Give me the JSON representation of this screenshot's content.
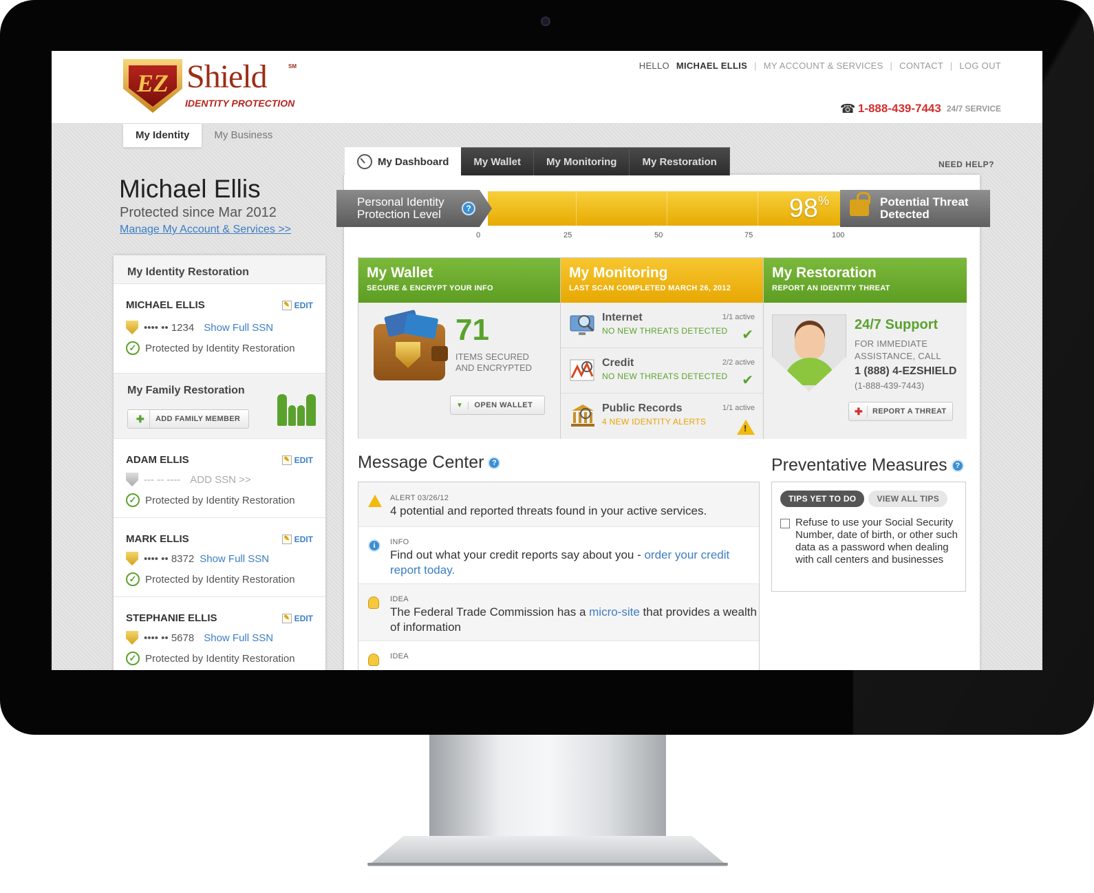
{
  "header": {
    "brand": {
      "word": "Shield",
      "badge": "EZ",
      "sub": "IDENTITY PROTECTION",
      "mark": "SM"
    },
    "links": {
      "hello": "HELLO",
      "user": "MICHAEL ELLIS",
      "sep": "|",
      "account": "MY ACCOUNT & SERVICES",
      "contact": "CONTACT",
      "logout": "LOG OUT"
    },
    "phone": {
      "number": "1-888-439-7443",
      "service": "24/7 SERVICE"
    }
  },
  "identity_tabs": [
    {
      "label": "My Identity",
      "active": true
    },
    {
      "label": "My Business",
      "active": false
    }
  ],
  "profile": {
    "name": "Michael Ellis",
    "since": "Protected since Mar 2012",
    "manage_link": "Manage My Account & Services >>"
  },
  "left": {
    "title": "My Identity Restoration",
    "edit_label": "EDIT",
    "protected_text": "Protected by Identity Restoration",
    "primary": {
      "name": "MICHAEL ELLIS",
      "ssn": "•••• •• 1234",
      "ssn_link": "Show Full SSN"
    },
    "family": {
      "title": "My Family Restoration",
      "add_button": "ADD FAMILY MEMBER"
    },
    "members": [
      {
        "name": "ADAM ELLIS",
        "ssn": "--- -- ----",
        "ssn_link": "ADD SSN >>"
      },
      {
        "name": "MARK ELLIS",
        "ssn": "•••• •• 8372",
        "ssn_link": "Show Full SSN"
      },
      {
        "name": "STEPHANIE ELLIS",
        "ssn": "•••• •• 5678",
        "ssn_link": "Show Full SSN"
      }
    ]
  },
  "main_tabs": [
    {
      "label": "My Dashboard",
      "active": true
    },
    {
      "label": "My Wallet",
      "active": false
    },
    {
      "label": "My Monitoring",
      "active": false
    },
    {
      "label": "My Restoration",
      "active": false
    }
  ],
  "need_help": "NEED HELP?",
  "protection": {
    "label_line1": "Personal Identity",
    "label_line2": "Protection Level",
    "help_icon": "?",
    "percent": 98,
    "percent_text": "98",
    "percent_sign": "%",
    "threat_line1": "Potential Threat",
    "threat_line2": "Detected",
    "ticks": [
      "0",
      "25",
      "50",
      "75",
      "100"
    ],
    "bar_color": "#f2b90e"
  },
  "wallet": {
    "title": "My Wallet",
    "subtitle": "SECURE & ENCRYPT YOUR INFO",
    "count": "71",
    "count_line1": "ITEMS SECURED",
    "count_line2": "AND ENCRYPTED",
    "button": "OPEN WALLET"
  },
  "monitoring": {
    "title": "My Monitoring",
    "subtitle": "LAST SCAN COMPLETED MARCH 26, 2012",
    "rows": [
      {
        "title": "Internet",
        "status": "NO NEW THREATS DETECTED",
        "active": "1/1 active",
        "icon": "magnifier-monitor-icon"
      },
      {
        "title": "Credit",
        "status": "NO NEW THREATS DETECTED",
        "active": "2/2 active",
        "icon": "credit-chart-icon"
      },
      {
        "title": "Public Records",
        "status": "4 NEW IDENTITY ALERTS",
        "active": "1/1 active",
        "icon": "courthouse-icon"
      }
    ]
  },
  "restoration": {
    "title": "My Restoration",
    "subtitle": "REPORT AN IDENTITY THREAT",
    "support_title": "24/7 Support",
    "support_line1": "FOR IMMEDIATE",
    "support_line2": "ASSISTANCE, CALL",
    "phone": "1 (888) 4-EZSHIELD",
    "phone2": "(1-888-439-7443)",
    "button": "REPORT A THREAT"
  },
  "message_center": {
    "title": "Message Center",
    "messages": [
      {
        "type": "ALERT 03/26/12",
        "text": "4 potential and reported threats found in your active services."
      },
      {
        "type": "INFO",
        "text": "Find out what your credit reports say about you - ",
        "link": "order your credit report today."
      },
      {
        "type": "IDEA",
        "text_before": "The Federal Trade Commission has a ",
        "link": "micro-site",
        "text_after": " that provides a wealth of information"
      },
      {
        "type": "IDEA"
      }
    ]
  },
  "preventative": {
    "title": "Preventative Measures",
    "tabs": [
      "TIPS YET TO DO",
      "VIEW ALL TIPS"
    ],
    "tip": "Refuse to use your Social Security Number, date of birth, or other such data as a password when dealing with call centers and businesses"
  }
}
